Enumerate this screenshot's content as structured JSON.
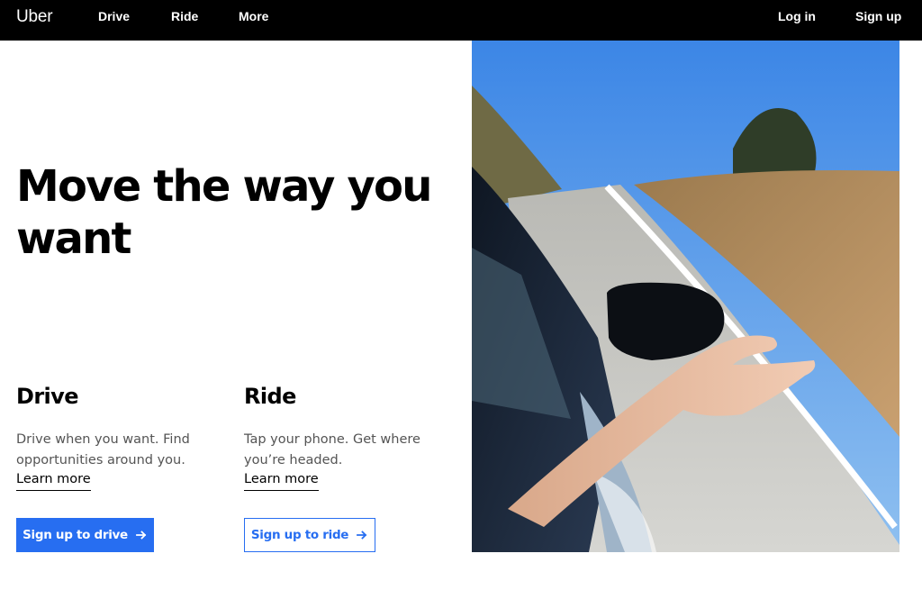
{
  "header": {
    "logo": "Uber",
    "nav": [
      "Drive",
      "Ride",
      "More"
    ],
    "login": "Log in",
    "signup": "Sign up"
  },
  "hero": {
    "title": "Move the way you want",
    "image_alt_icon": "car-window-photo"
  },
  "drive": {
    "heading": "Drive",
    "description": "Drive when you want. Find opportunities around you.",
    "learn_more": "Learn more",
    "button": "Sign up to drive"
  },
  "ride": {
    "heading": "Ride",
    "description": "Tap your phone. Get where you’re headed.",
    "learn_more": "Learn more",
    "button": "Sign up to ride"
  },
  "colors": {
    "nav_bg": "#000000",
    "accent": "#276ef1",
    "text": "#000000",
    "muted": "#545454"
  },
  "icons": [
    "arrow-right-icon"
  ]
}
